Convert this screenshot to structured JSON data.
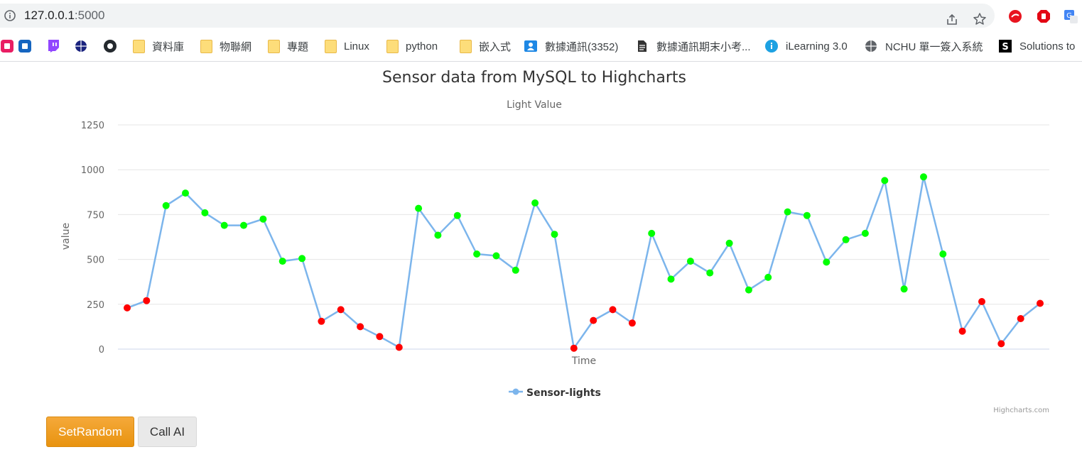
{
  "browser": {
    "url_host": "127.0.0.1",
    "url_port": ":5000",
    "icons": [
      "info-icon",
      "share-icon",
      "star-icon",
      "extension-icon",
      "extension-icon",
      "translate-icon"
    ]
  },
  "bookmarks": [
    {
      "label": "",
      "icon": "bookmark-icon",
      "color": "#e91e63"
    },
    {
      "label": "",
      "icon": "bookmark-icon",
      "color": "#1565c0"
    },
    {
      "label": "",
      "icon": "twitch-icon",
      "color": "#9146ff"
    },
    {
      "label": "",
      "icon": "globe-icon",
      "color": "#1a237e"
    },
    {
      "label": "",
      "icon": "github-icon",
      "color": "#24292e"
    },
    {
      "label": "資料庫",
      "icon": "folder-icon"
    },
    {
      "label": "物聯網",
      "icon": "folder-icon"
    },
    {
      "label": "專題",
      "icon": "folder-icon"
    },
    {
      "label": "Linux",
      "icon": "folder-icon"
    },
    {
      "label": "python",
      "icon": "folder-icon"
    },
    {
      "label": "嵌入式",
      "icon": "folder-icon"
    },
    {
      "label": "數據通訊(3352)",
      "icon": "classroom-icon",
      "color": "#1e88e5"
    },
    {
      "label": "數據通訊期末小考...",
      "icon": "document-icon",
      "color": "#333333"
    },
    {
      "label": "iLearning 3.0",
      "icon": "info-circle-icon",
      "color": "#1da1e2"
    },
    {
      "label": "NCHU 單一簽入系統",
      "icon": "globe-icon",
      "color": "#5f6368"
    },
    {
      "label": "Solutions to",
      "icon": "s-logo-icon",
      "color": "#000000"
    }
  ],
  "chart_data": {
    "type": "line",
    "title": "Sensor data from MySQL to Highcharts",
    "subtitle": "Light Value",
    "xlabel": "Time",
    "ylabel": "value",
    "ylim": [
      0,
      1250
    ],
    "yticks": [
      0,
      250,
      500,
      750,
      1000,
      1250
    ],
    "grid": true,
    "legend_position": "bottom-center",
    "credits": "Highcharts.com",
    "line_color": "#7cb5ec",
    "threshold": 300,
    "colors": {
      "above": "#00ff00",
      "below": "#ff0000"
    },
    "series": [
      {
        "name": "Sensor-lights",
        "values": [
          230,
          270,
          800,
          870,
          760,
          690,
          690,
          725,
          490,
          505,
          155,
          220,
          125,
          70,
          10,
          785,
          635,
          745,
          530,
          520,
          440,
          815,
          640,
          5,
          160,
          220,
          145,
          645,
          390,
          490,
          425,
          590,
          330,
          400,
          765,
          745,
          485,
          610,
          645,
          940,
          335,
          960,
          530,
          100,
          265,
          30,
          170,
          255
        ]
      }
    ]
  },
  "buttons": {
    "setrandom": "SetRandom",
    "callai": "Call AI"
  }
}
